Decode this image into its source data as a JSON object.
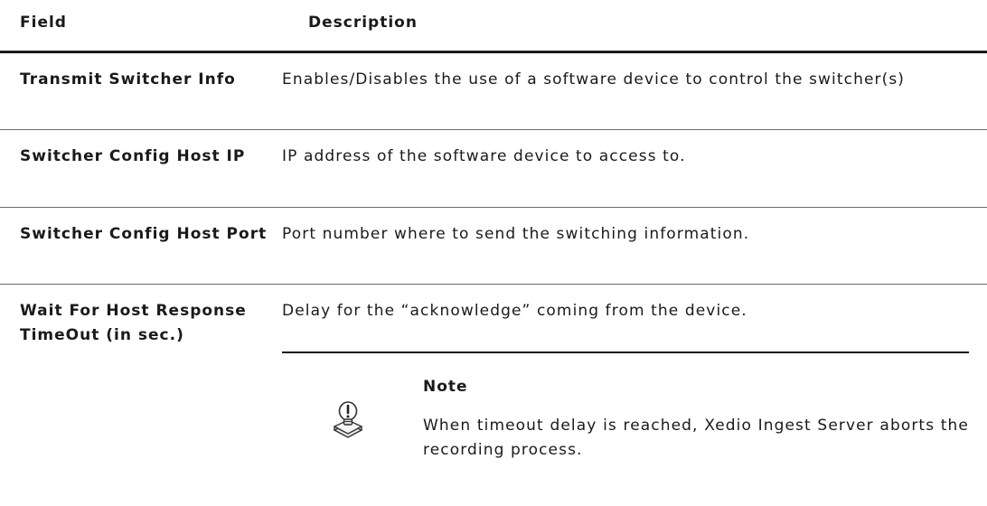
{
  "header": {
    "field": "Field",
    "description": "Description"
  },
  "rows": [
    {
      "field": "Transmit Switcher Info",
      "description": "Enables/Disables the use of a software device to control the switcher(s)"
    },
    {
      "field": "Switcher Config Host IP",
      "description": "IP address of the software device to access to."
    },
    {
      "field": "Switcher Config Host Port",
      "description": "Port number where to send the switching information."
    },
    {
      "field": "Wait For Host Response TimeOut (in sec.)",
      "description": "Delay for the “acknowledge” coming from the device."
    }
  ],
  "note": {
    "title": "Note",
    "text": "When timeout delay is reached, Xedio Ingest Server aborts the recording process.",
    "icon": "note-bulb-icon"
  }
}
